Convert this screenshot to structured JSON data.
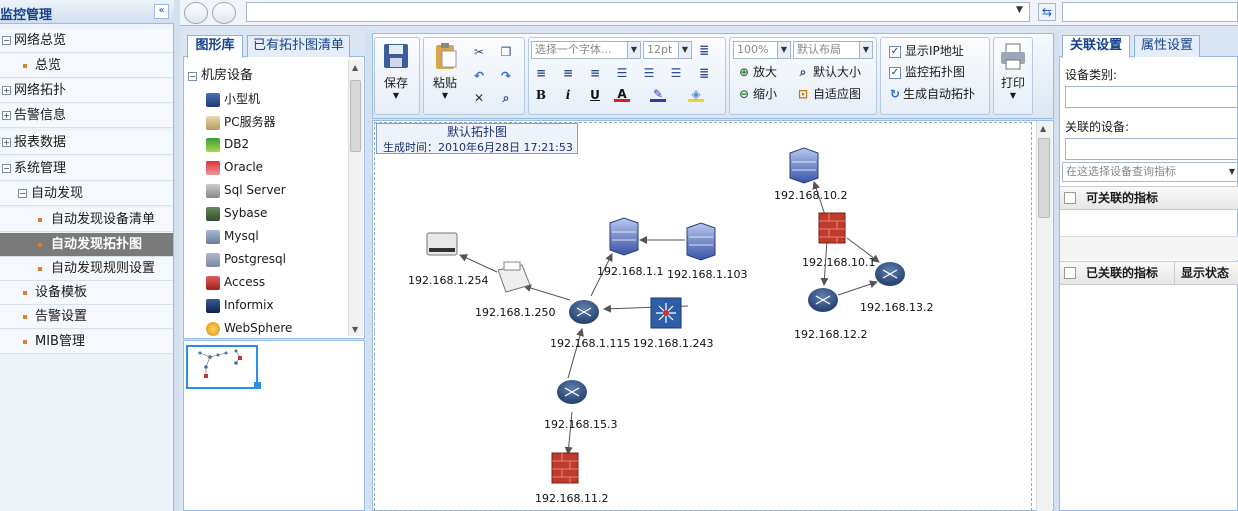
{
  "leftnav": {
    "title": "监控管理",
    "collapse": "«",
    "items": [
      {
        "label": "网络总览",
        "kind": "group"
      },
      {
        "label": "总览",
        "kind": "leaf"
      },
      {
        "label": "网络拓扑",
        "kind": "group"
      },
      {
        "label": "告警信息",
        "kind": "group"
      },
      {
        "label": "报表数据",
        "kind": "group"
      },
      {
        "label": "系统管理",
        "kind": "group"
      },
      {
        "label": "自动发现",
        "kind": "subgroup"
      },
      {
        "label": "自动发现设备清单",
        "kind": "subleaf"
      },
      {
        "label": "自动发现拓扑图",
        "kind": "subleaf",
        "selected": true
      },
      {
        "label": "自动发现规则设置",
        "kind": "subleaf"
      },
      {
        "label": "设备模板",
        "kind": "leaf"
      },
      {
        "label": "告警设置",
        "kind": "leaf"
      },
      {
        "label": "MIB管理",
        "kind": "leaf"
      }
    ]
  },
  "library": {
    "tabs": [
      "图形库",
      "已有拓扑图清单"
    ],
    "group": "机房设备",
    "items": [
      "小型机",
      "PC服务器",
      "DB2",
      "Oracle",
      "Sql Server",
      "Sybase",
      "Mysql",
      "Postgresql",
      "Access",
      "Informix",
      "WebSphere"
    ]
  },
  "toolbar": {
    "save": "保存",
    "paste": "粘贴",
    "font_placeholder": "选择一个字体...",
    "font_size": "12pt",
    "zoom": "100%",
    "layout": "默认布局",
    "zoom_in": "放大",
    "zoom_out": "缩小",
    "default_size": "默认大小",
    "fit": "自适应图",
    "show_ip": "显示IP地址",
    "monitor_topo": "监控拓扑图",
    "gen_auto_topo": "生成自动拓扑",
    "print": "打印",
    "fmt_bold": "B",
    "fmt_italic": "i",
    "fmt_underline": "U",
    "fmt_fontcolor": "A"
  },
  "canvas": {
    "title": "默认拓扑图",
    "time": "生成时间：2010年6月28日  17:21:53",
    "nodes": [
      "192.168.1.254",
      "192.168.1.250",
      "192.168.1.1",
      "192.168.1.103",
      "192.168.1.115",
      "192.168.1.243",
      "192.168.15.3",
      "192.168.11.2",
      "192.168.10.2",
      "192.168.10.1",
      "192.168.13.2",
      "192.168.12.2"
    ]
  },
  "rightpanel": {
    "tabs": [
      "关联设置",
      "属性设置"
    ],
    "device_type_label": "设备类别:",
    "related_device_label": "关联的设备:",
    "search_placeholder": "在这选择设备查询指标",
    "grid1_header": "可关联的指标",
    "grid2_header1": "已关联的指标",
    "grid2_header2": "显示状态"
  },
  "colors": {
    "accent": "#15428b",
    "selected_nav": "#7a7a7a",
    "firewall": "#c0392b",
    "router": "#2c4e7d"
  }
}
